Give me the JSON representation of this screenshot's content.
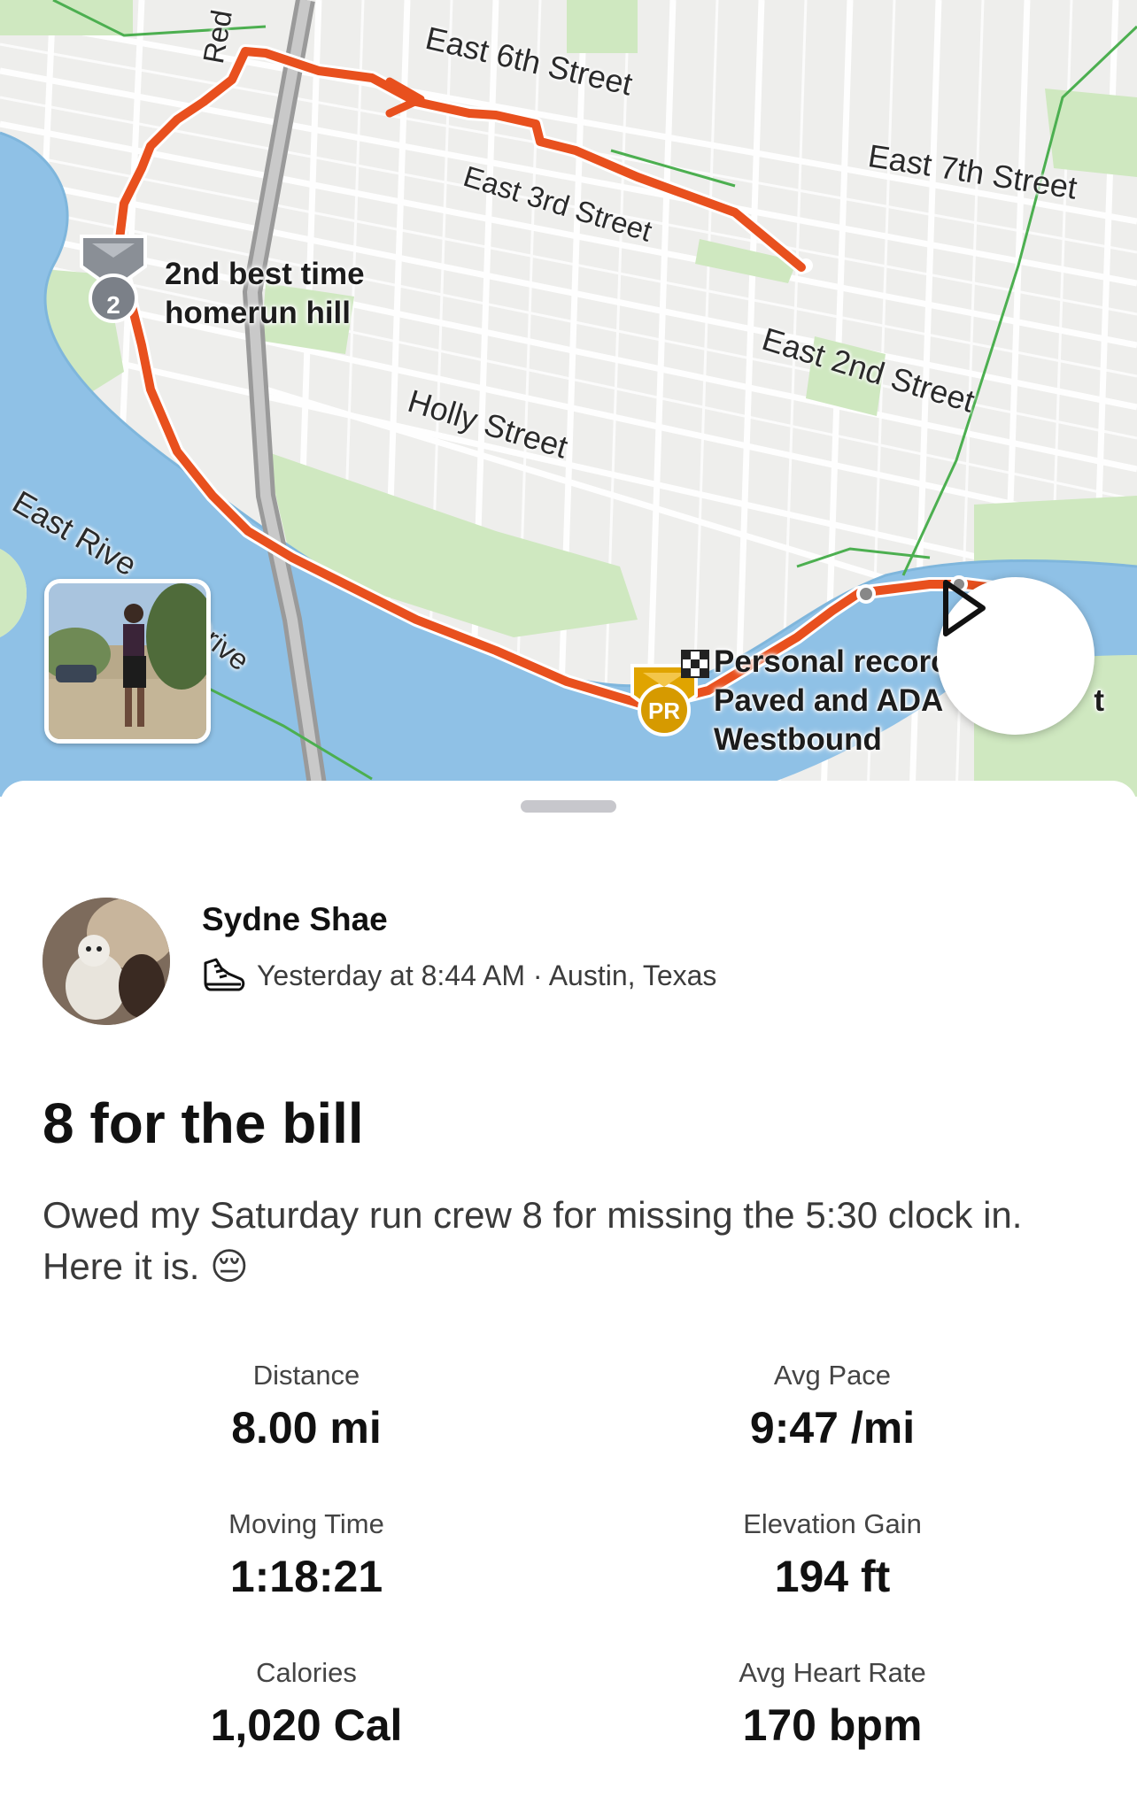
{
  "map": {
    "streets": [
      "East 6th Street",
      "East 7th Street",
      "East 3rd Street",
      "East 2nd Street",
      "Holly Street",
      "East Rive",
      "Drive",
      "Red"
    ],
    "segments": [
      {
        "badge": "2",
        "label_line1": "2nd best time",
        "label_line2": "homerun hill"
      },
      {
        "badge": "PR",
        "label_line1": "Personal recorc",
        "label_line2": "Paved and ADA",
        "label_line2_tail": "t",
        "label_line3": "Westbound"
      }
    ],
    "route_color": "#e8501e",
    "water_color": "#8fc1e6",
    "park_color": "#cfe8c0"
  },
  "activity": {
    "athlete_name": "Sydne Shae",
    "timestamp_location": "Yesterday at 8:44 AM · Austin, Texas",
    "title": "8 for the bill",
    "description": "Owed my Saturday run crew 8 for missing the 5:30 clock in. Here it is. 😔",
    "sport_icon": "running-shoe-icon"
  },
  "stats": [
    {
      "label": "Distance",
      "value": "8.00 mi"
    },
    {
      "label": "Avg Pace",
      "value": "9:47 /mi"
    },
    {
      "label": "Moving Time",
      "value": "1:18:21"
    },
    {
      "label": "Elevation Gain",
      "value": "194 ft"
    },
    {
      "label": "Calories",
      "value": "1,020 Cal"
    },
    {
      "label": "Avg Heart Rate",
      "value": "170 bpm"
    }
  ]
}
